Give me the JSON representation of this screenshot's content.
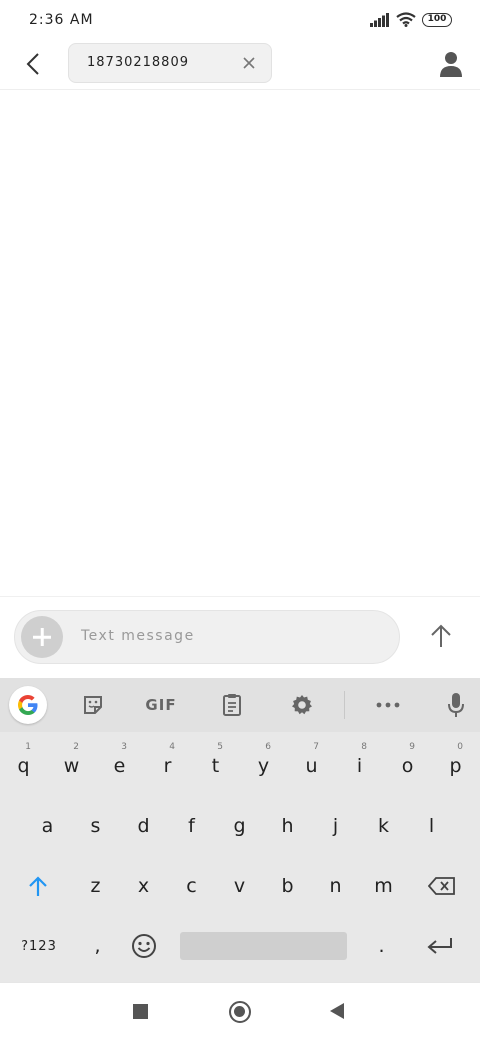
{
  "status_bar": {
    "time": "2:36 AM",
    "battery": "100",
    "icons": [
      "signal-icon",
      "wifi-icon",
      "battery-icon"
    ]
  },
  "header": {
    "recipient": "18730218809",
    "icons": [
      "back-arrow-icon",
      "close-icon",
      "contact-icon"
    ]
  },
  "compose": {
    "placeholder": "Text message",
    "icons": [
      "plus-icon",
      "send-arrow-icon"
    ]
  },
  "keyboard": {
    "toolbar": {
      "gif_label": "GIF",
      "icons": [
        "google-g-icon",
        "sticker-icon",
        "clipboard-icon",
        "settings-gear-icon",
        "more-dots-icon",
        "microphone-icon"
      ]
    },
    "row1": [
      {
        "key": "q",
        "hint": "1"
      },
      {
        "key": "w",
        "hint": "2"
      },
      {
        "key": "e",
        "hint": "3"
      },
      {
        "key": "r",
        "hint": "4"
      },
      {
        "key": "t",
        "hint": "5"
      },
      {
        "key": "y",
        "hint": "6"
      },
      {
        "key": "u",
        "hint": "7"
      },
      {
        "key": "i",
        "hint": "8"
      },
      {
        "key": "o",
        "hint": "9"
      },
      {
        "key": "p",
        "hint": "0"
      }
    ],
    "row2": [
      "a",
      "s",
      "d",
      "f",
      "g",
      "h",
      "j",
      "k",
      "l"
    ],
    "row3": [
      "z",
      "x",
      "c",
      "v",
      "b",
      "n",
      "m"
    ],
    "row4": {
      "symbols": "?123",
      "comma": ",",
      "period": "."
    },
    "icons": [
      "shift-arrow-icon",
      "backspace-icon",
      "emoji-icon",
      "enter-icon"
    ],
    "accent_color": "#2196f3"
  },
  "nav_bar": {
    "icons": [
      "recents-square-icon",
      "home-circle-icon",
      "back-triangle-icon"
    ]
  }
}
